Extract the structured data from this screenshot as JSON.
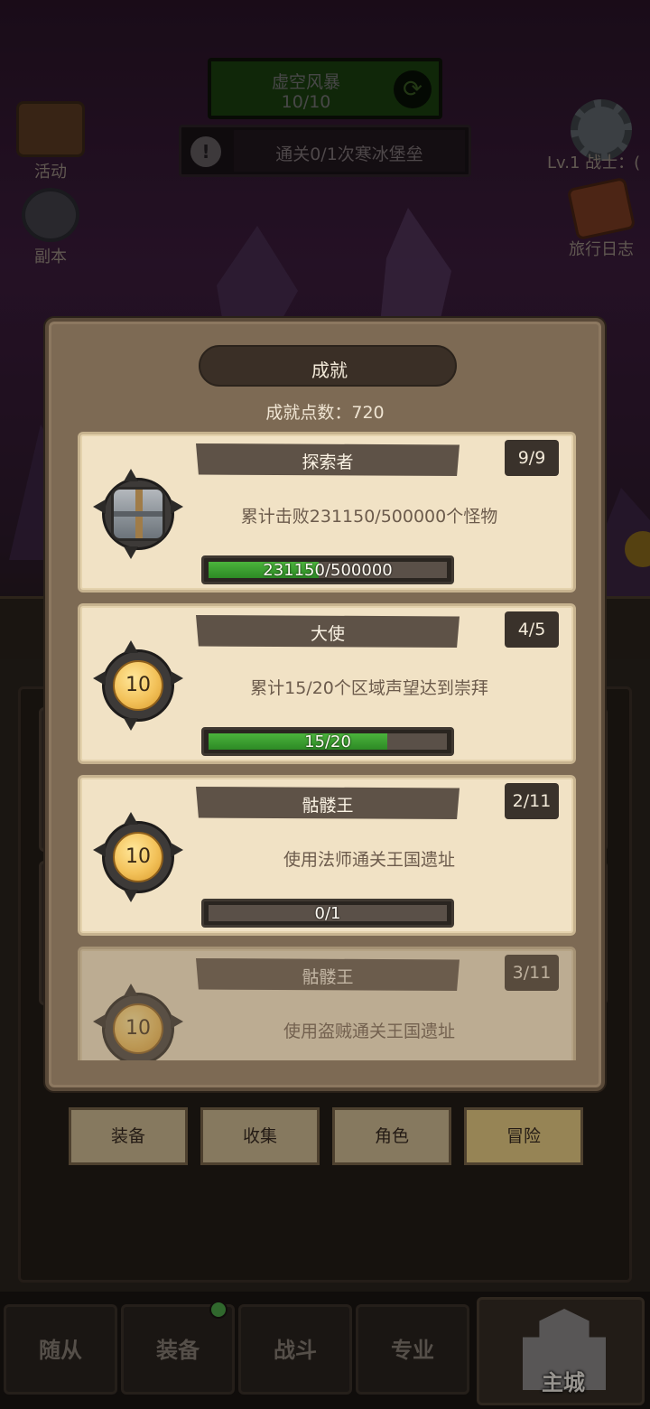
{
  "hud": {
    "event_title": "虚空风暴",
    "event_count": "10/10",
    "refresh_icon": "refresh-icon",
    "quest_text": "通关0/1次寒冰堡垒",
    "activity_label": "活动",
    "dungeon_label": "副本",
    "level_text": "Lv.1 战士：(",
    "journal_label": "旅行日志"
  },
  "tabs": [
    {
      "label": "装备",
      "active": false
    },
    {
      "label": "收集",
      "active": false
    },
    {
      "label": "角色",
      "active": false
    },
    {
      "label": "冒险",
      "active": true
    }
  ],
  "nav": {
    "items": [
      "随从",
      "装备",
      "战斗",
      "专业"
    ],
    "castle_label": "主城",
    "badge_on": "装备"
  },
  "modal": {
    "title": "成就",
    "points": "成就点数：720",
    "cards": [
      {
        "title": "探索者",
        "count": "9/9",
        "icon": "treasure-chest-icon",
        "medal": "",
        "desc": "累计击败231150/500000个怪物",
        "progress_label": "231150/500000",
        "progress": 0.4623,
        "faded": false
      },
      {
        "title": "大使",
        "count": "4/5",
        "icon": "medal-icon",
        "medal": "10",
        "desc": "累计15/20个区域声望达到崇拜",
        "progress_label": "15/20",
        "progress": 0.75,
        "faded": false
      },
      {
        "title": "骷髅王",
        "count": "2/11",
        "icon": "medal-icon",
        "medal": "10",
        "desc": "使用法师通关王国遗址",
        "progress_label": "0/1",
        "progress": 0,
        "faded": false
      },
      {
        "title": "骷髅王",
        "count": "3/11",
        "icon": "medal-icon",
        "medal": "10",
        "desc": "使用盗贼通关王国遗址",
        "progress_label": "",
        "progress": 0,
        "faded": true
      }
    ]
  }
}
